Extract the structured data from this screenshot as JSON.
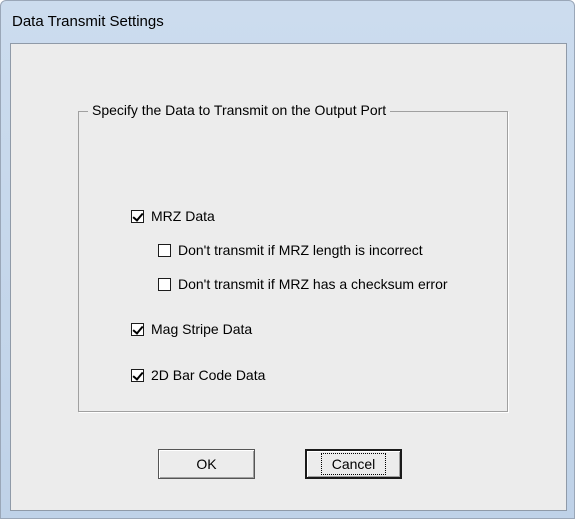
{
  "window": {
    "title": "Data Transmit Settings"
  },
  "group": {
    "legend": "Specify the Data to Transmit on the Output Port",
    "options": [
      {
        "label": "MRZ Data",
        "checked": true
      },
      {
        "label": "Don't transmit if MRZ length is incorrect",
        "checked": false
      },
      {
        "label": "Don't transmit if MRZ has a checksum error",
        "checked": false
      },
      {
        "label": "Mag Stripe Data",
        "checked": true
      },
      {
        "label": "2D Bar Code Data",
        "checked": true
      }
    ]
  },
  "buttons": {
    "ok_label": "OK",
    "cancel_label": "Cancel"
  }
}
